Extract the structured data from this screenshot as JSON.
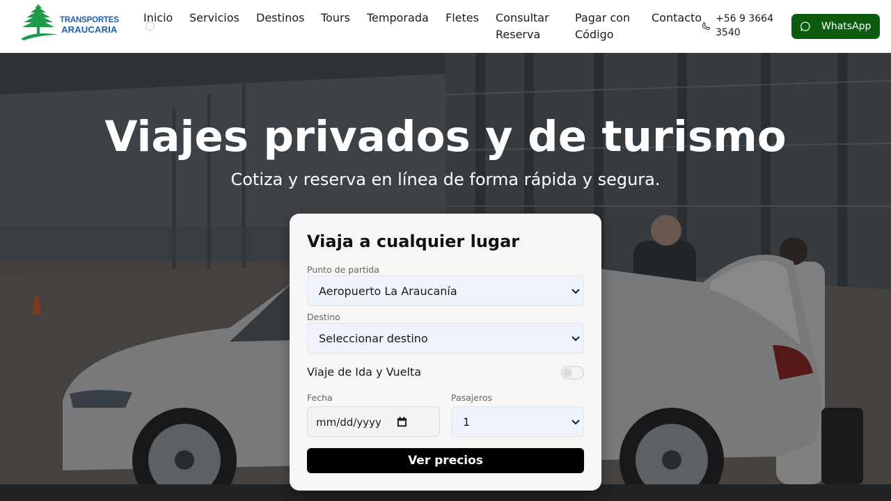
{
  "brand": {
    "name_line1": "TRANSPORTES",
    "name_line2": "ARAUCARIA",
    "logo_icon": "araucaria-tree-icon",
    "logo_color": "#1f5ea8",
    "tree_color": "#1f9a4a"
  },
  "nav": {
    "items": [
      {
        "label": "Inicio"
      },
      {
        "label": "Servicios"
      },
      {
        "label": "Destinos"
      },
      {
        "label": "Tours"
      },
      {
        "label": "Temporada"
      },
      {
        "label": "Fletes"
      },
      {
        "label": "Consultar Reserva"
      },
      {
        "label": "Pagar con Código"
      },
      {
        "label": "Contacto"
      }
    ]
  },
  "contact": {
    "phone": "+56 9 3664 3540",
    "phone_icon": "phone-icon",
    "whatsapp_label": "WhatsApp",
    "whatsapp_icon": "whatsapp-icon",
    "whatsapp_color": "#0c5b0f"
  },
  "hero": {
    "title": "Viajes privados y de turismo",
    "subtitle": "Cotiza y reserva en línea de forma rápida y segura."
  },
  "booking": {
    "title": "Viaja a cualquier lugar",
    "origin_label": "Punto de partida",
    "origin_value": "Aeropuerto La Araucanía",
    "destination_label": "Destino",
    "destination_value": "Seleccionar destino",
    "round_trip_label": "Viaje de Ida y Vuelta",
    "round_trip_on": false,
    "date_label": "Fecha",
    "date_placeholder": "mm/dd/yyyy",
    "passengers_label": "Pasajeros",
    "passengers_value": "1",
    "submit_label": "Ver precios"
  }
}
